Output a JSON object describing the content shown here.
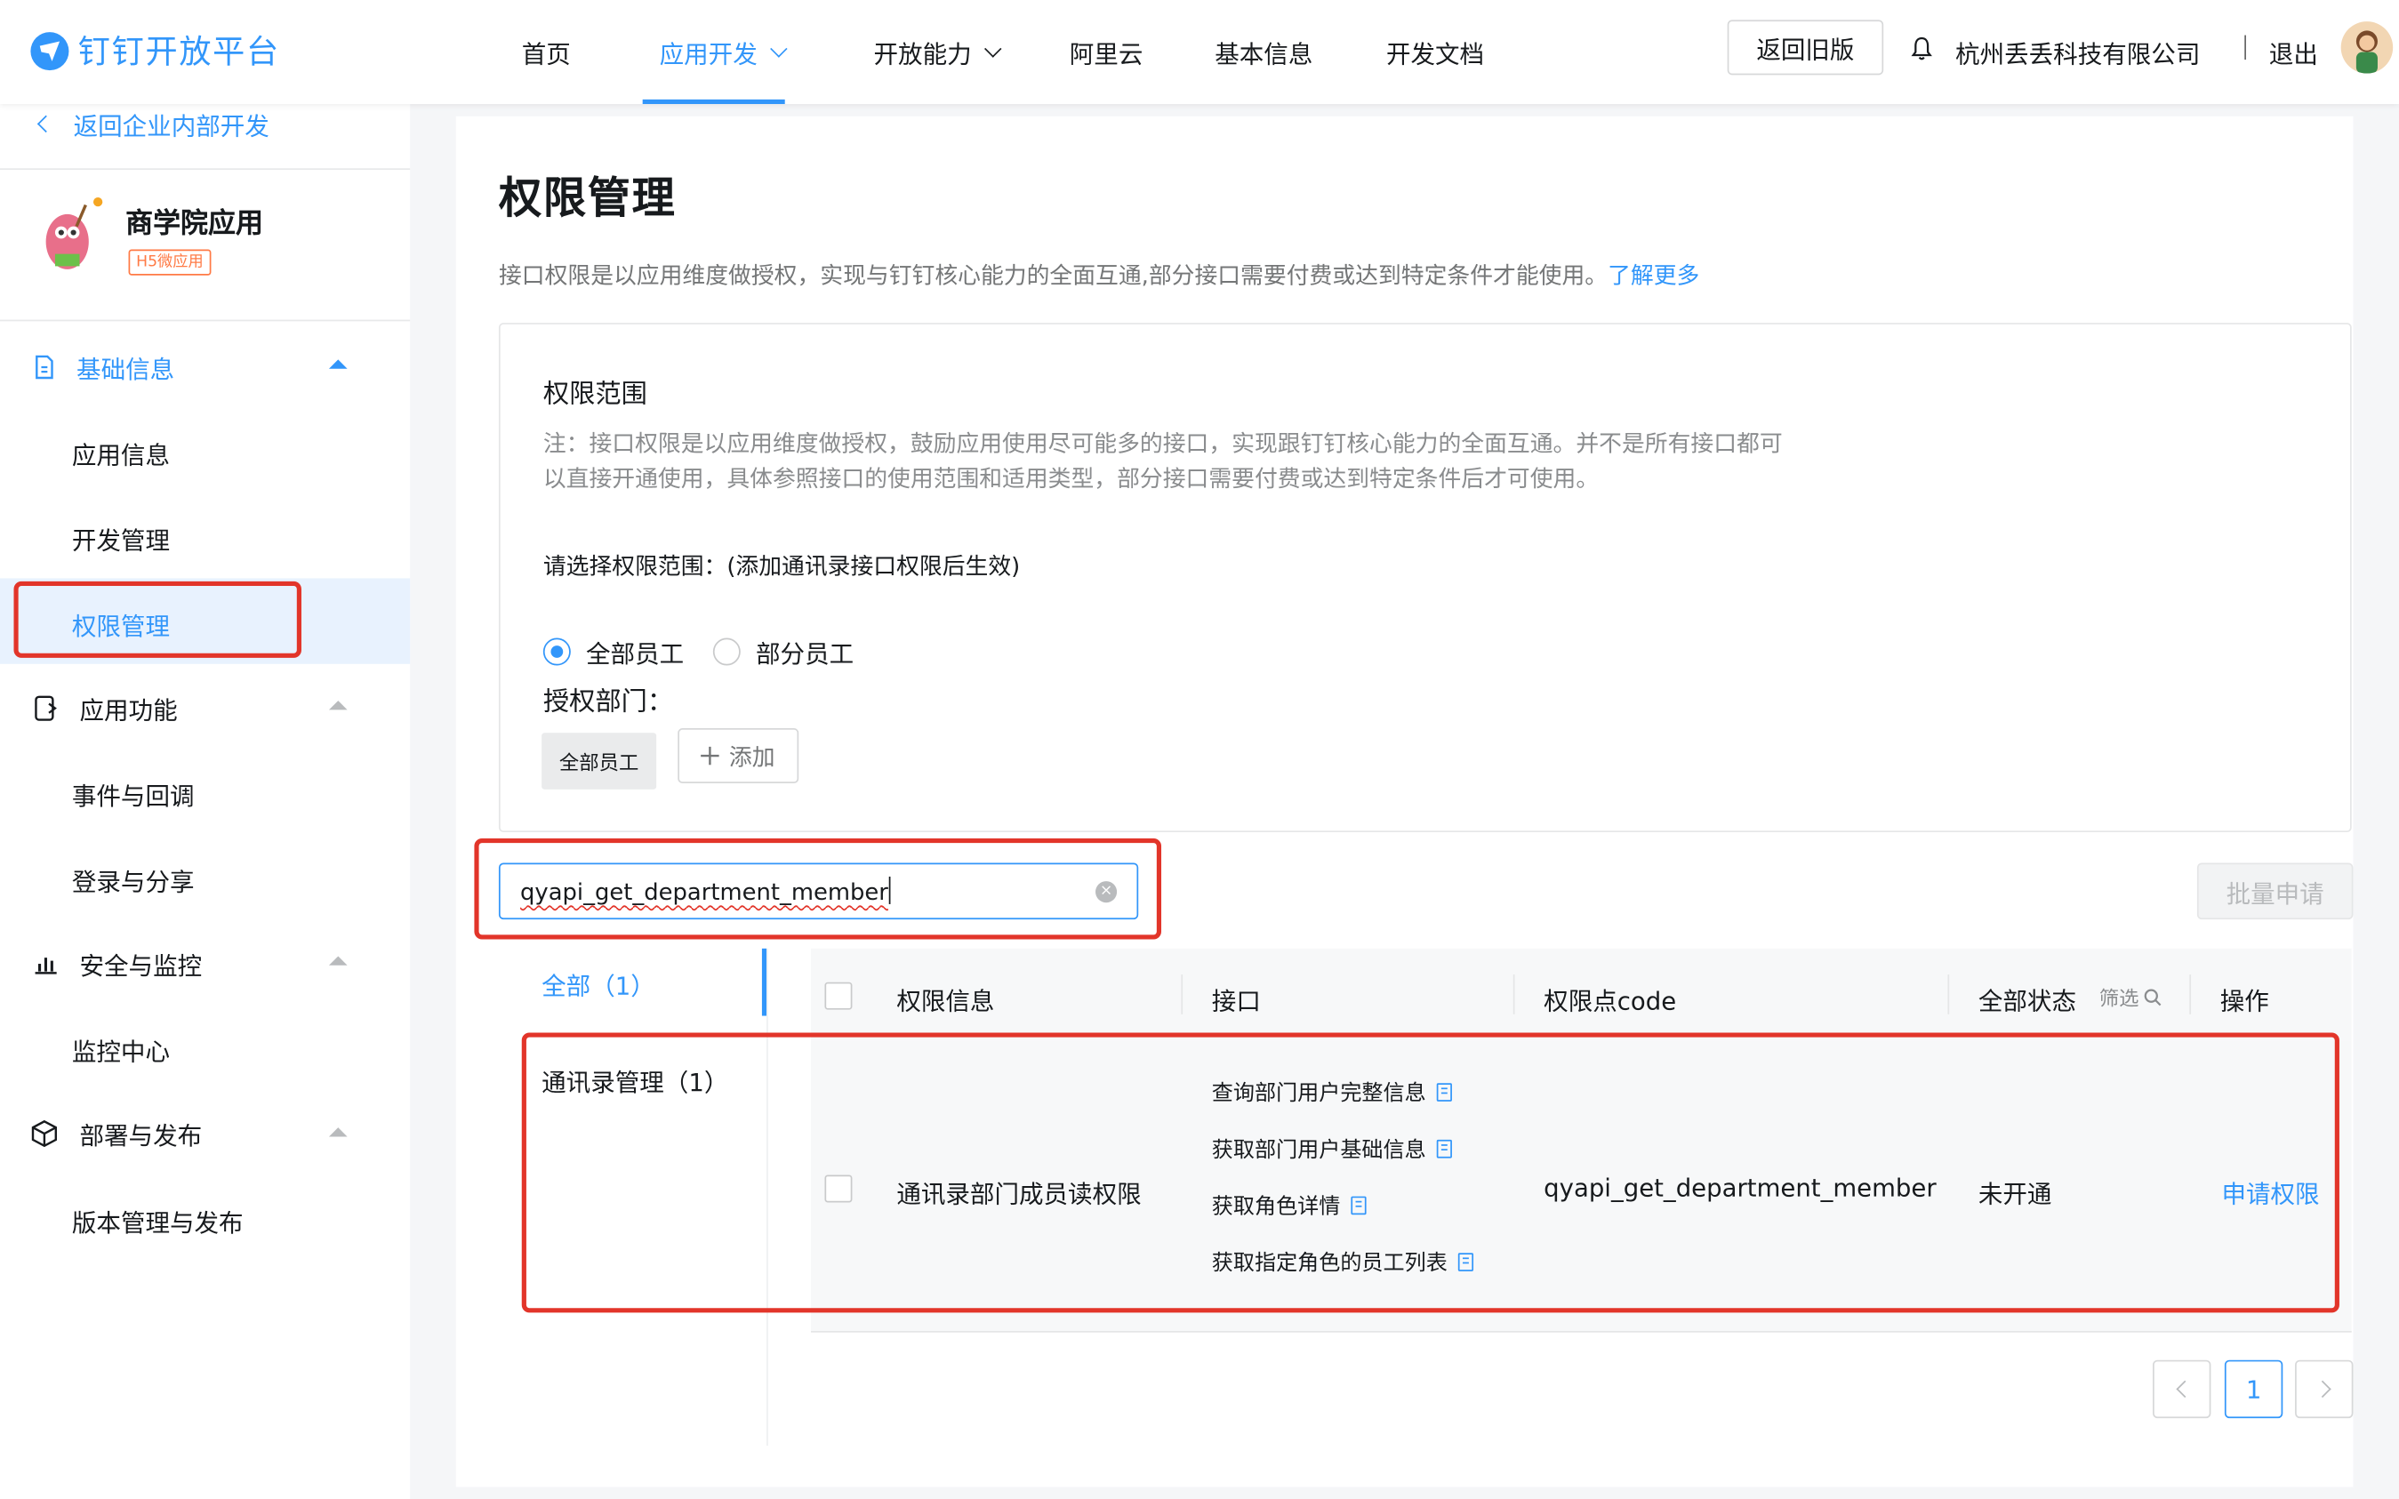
{
  "header": {
    "logo_text": "钉钉开放平台",
    "nav": [
      {
        "label": "首页"
      },
      {
        "label": "应用开发"
      },
      {
        "label": "开放能力"
      },
      {
        "label": "阿里云"
      },
      {
        "label": "基本信息"
      },
      {
        "label": "开发文档"
      }
    ],
    "old_version_label": "返回旧版",
    "company": "杭州丢丢科技有限公司",
    "logout": "退出"
  },
  "sidebar": {
    "back_label": "返回企业内部开发",
    "app_name": "商学院应用",
    "app_badge": "H5微应用",
    "groups": [
      {
        "label": "基础信息",
        "items": [
          "应用信息",
          "开发管理",
          "权限管理"
        ]
      },
      {
        "label": "应用功能",
        "items": [
          "事件与回调",
          "登录与分享"
        ]
      },
      {
        "label": "安全与监控",
        "items": [
          "监控中心"
        ]
      },
      {
        "label": "部署与发布",
        "items": [
          "版本管理与发布"
        ]
      }
    ],
    "active_item": "权限管理"
  },
  "main": {
    "title": "权限管理",
    "desc": "接口权限是以应用维度做授权，实现与钉钉核心能力的全面互通,部分接口需要付费或达到特定条件才能使用。",
    "learn_more": "了解更多",
    "scope": {
      "title": "权限范围",
      "note": "注：接口权限是以应用维度做授权，鼓励应用使用尽可能多的接口，实现跟钉钉核心能力的全面互通。并不是所有接口都可以直接开通使用，具体参照接口的使用范围和适用类型，部分接口需要付费或达到特定条件后才可使用。",
      "hint": "请选择权限范围：(添加通讯录接口权限后生效)",
      "radio_all": "全部员工",
      "radio_part": "部分员工",
      "dept_label": "授权部门：",
      "dept_tag": "全部员工",
      "add_label": "添加"
    },
    "search": {
      "value": "qyapi_get_department_member"
    },
    "batch_label": "批量申请",
    "categories": [
      {
        "label": "全部（1）"
      },
      {
        "label": "通讯录管理（1）"
      }
    ],
    "table": {
      "headers": [
        "权限信息",
        "接口",
        "权限点code",
        "全部状态",
        "操作"
      ],
      "filter_label": "筛选",
      "rows": [
        {
          "permission": "通讯录部门成员读权限",
          "apis": [
            "查询部门用户完整信息",
            "获取部门用户基础信息",
            "获取角色详情",
            "获取指定角色的员工列表"
          ],
          "code": "qyapi_get_department_member",
          "status": "未开通",
          "action": "申请权限"
        }
      ]
    },
    "pagination": {
      "current": "1"
    }
  }
}
